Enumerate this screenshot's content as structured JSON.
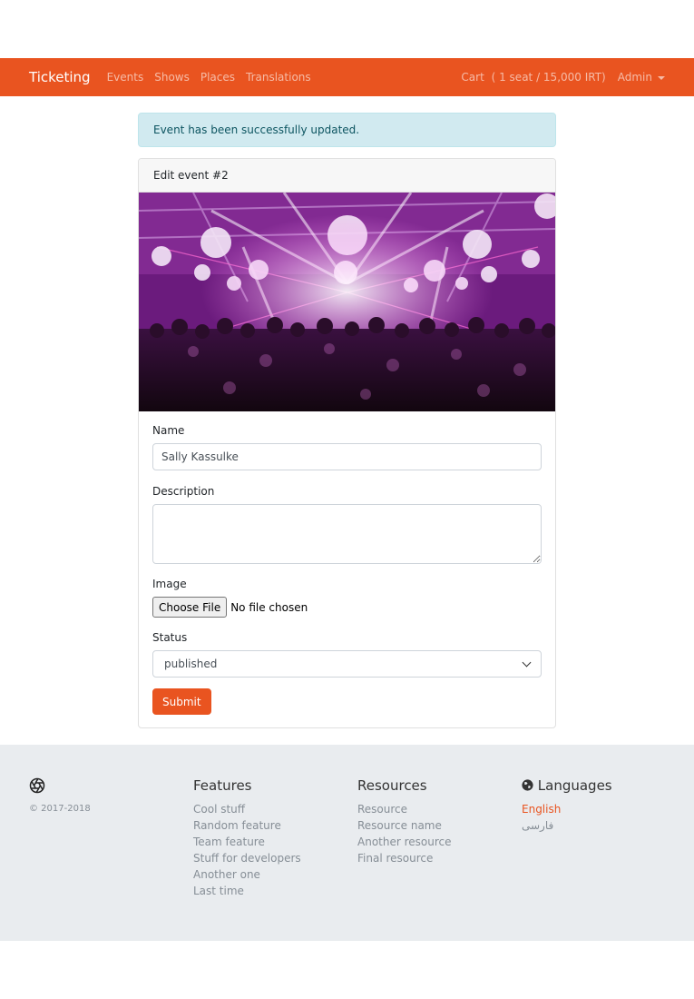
{
  "nav": {
    "brand": "Ticketing",
    "links": [
      "Events",
      "Shows",
      "Places",
      "Translations"
    ],
    "cart": "Cart",
    "cart_summary": "( 1 seat / 15,000 IRT)",
    "user": "Admin"
  },
  "alert": {
    "message": "Event has been successfully updated."
  },
  "card": {
    "header": "Edit event #2",
    "image_alt": "concert crowd with purple lights"
  },
  "form": {
    "name_label": "Name",
    "name_value": "Sally Kassulke",
    "description_label": "Description",
    "description_value": "",
    "image_label": "Image",
    "file_button": "Choose File",
    "file_status": "No file chosen",
    "status_label": "Status",
    "status_value": "published",
    "submit_label": "Submit"
  },
  "footer": {
    "logo_icon": "aperture-icon",
    "copyright": "© 2017-2018",
    "features": {
      "title": "Features",
      "items": [
        "Cool stuff",
        "Random feature",
        "Team feature",
        "Stuff for developers",
        "Another one",
        "Last time"
      ]
    },
    "resources": {
      "title": "Resources",
      "items": [
        "Resource",
        "Resource name",
        "Another resource",
        "Final resource"
      ]
    },
    "languages": {
      "title": "Languages",
      "icon": "globe-icon",
      "items": [
        "English",
        "فارسی"
      ],
      "active": "English"
    }
  },
  "colors": {
    "accent": "#e95420",
    "alert_bg": "#d1eaf0",
    "footer_bg": "#e9ecef"
  }
}
